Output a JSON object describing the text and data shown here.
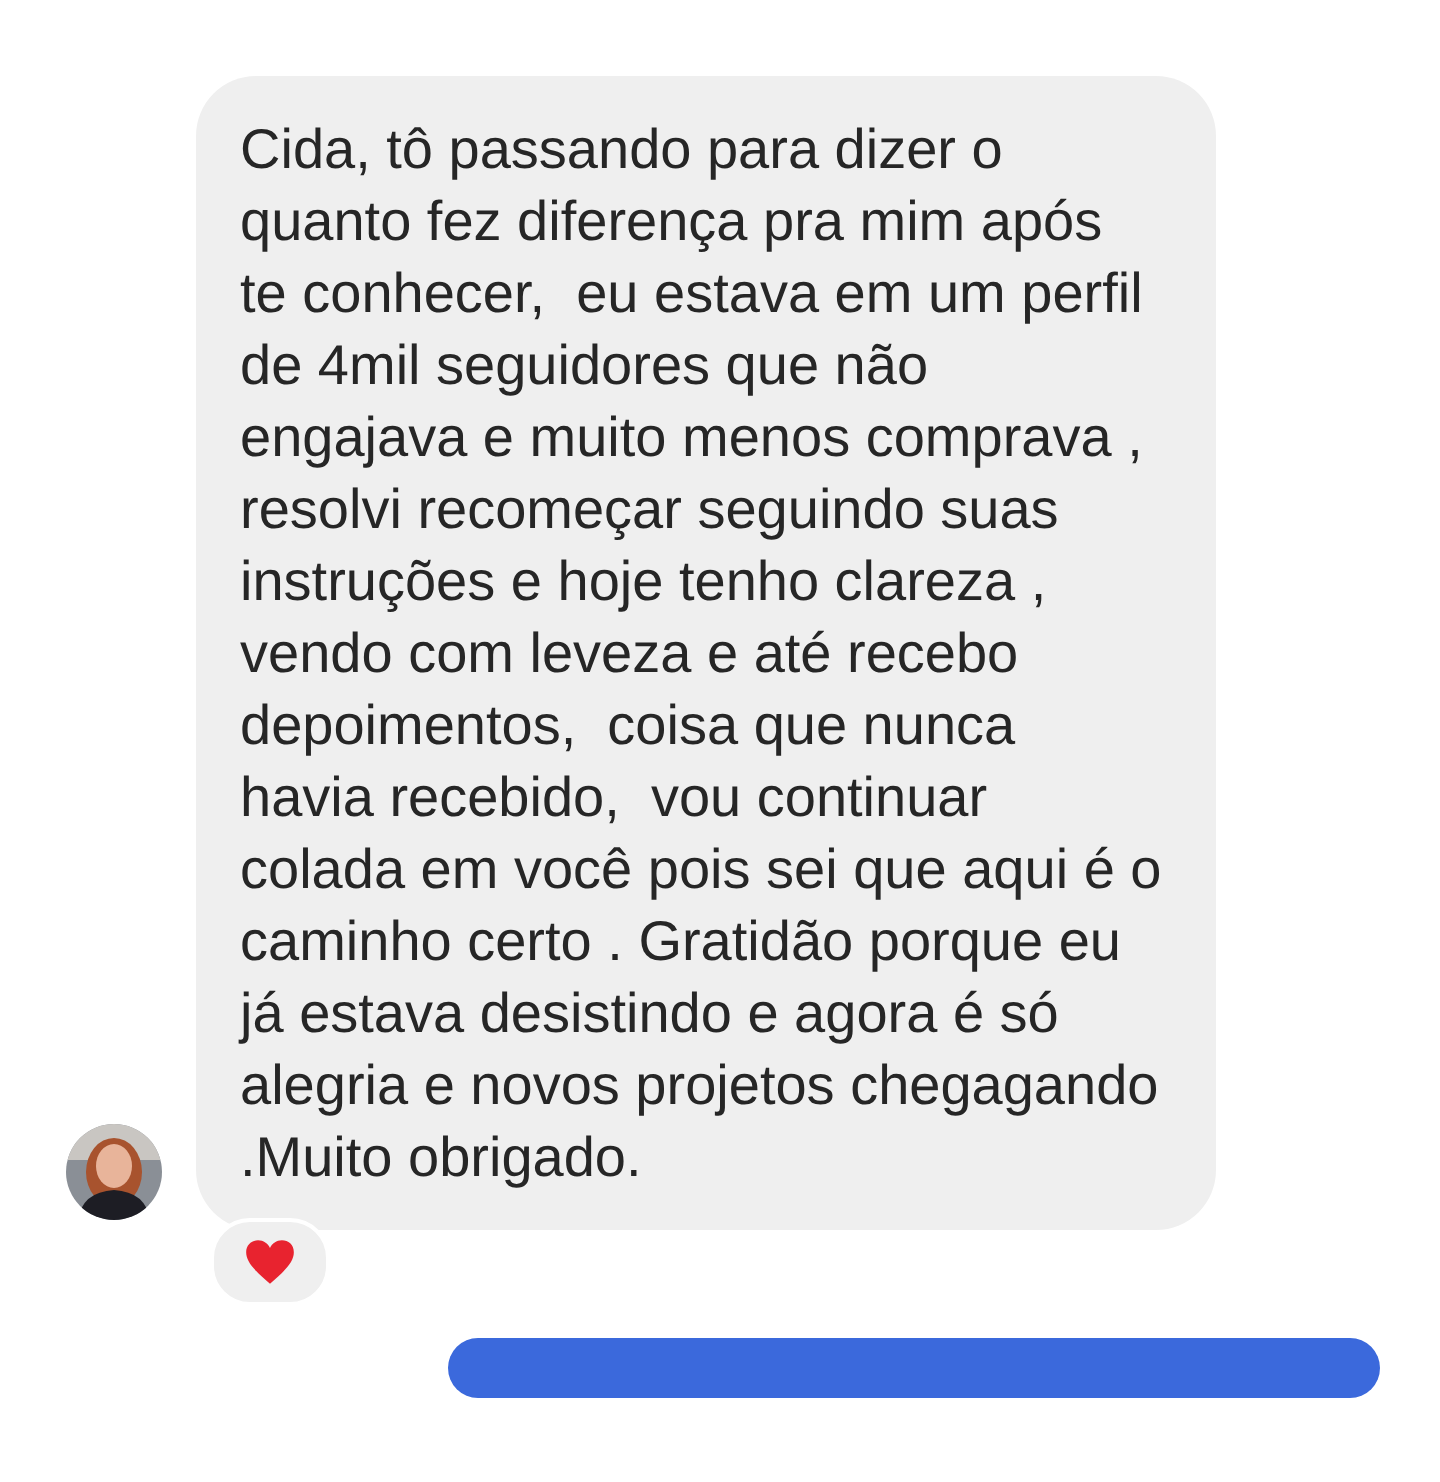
{
  "messages": [
    {
      "kind": "received",
      "text": "Cida, tô passando para dizer o quanto fez diferença pra mim após te conhecer,  eu estava em um perfil de 4mil seguidores que não engajava e muito menos comprava , resolvi recomeçar seguindo suas instruções e hoje tenho clareza , vendo com leveza e até recebo depoimentos,  coisa que nunca havia recebido,  vou continuar colada em você pois sei que aqui é o caminho certo . Gratidão porque eu já estava desistindo e agora é só alegria e novos projetos chegagando .Muito obrigado.",
      "reacted": true
    },
    {
      "kind": "sent"
    }
  ]
}
